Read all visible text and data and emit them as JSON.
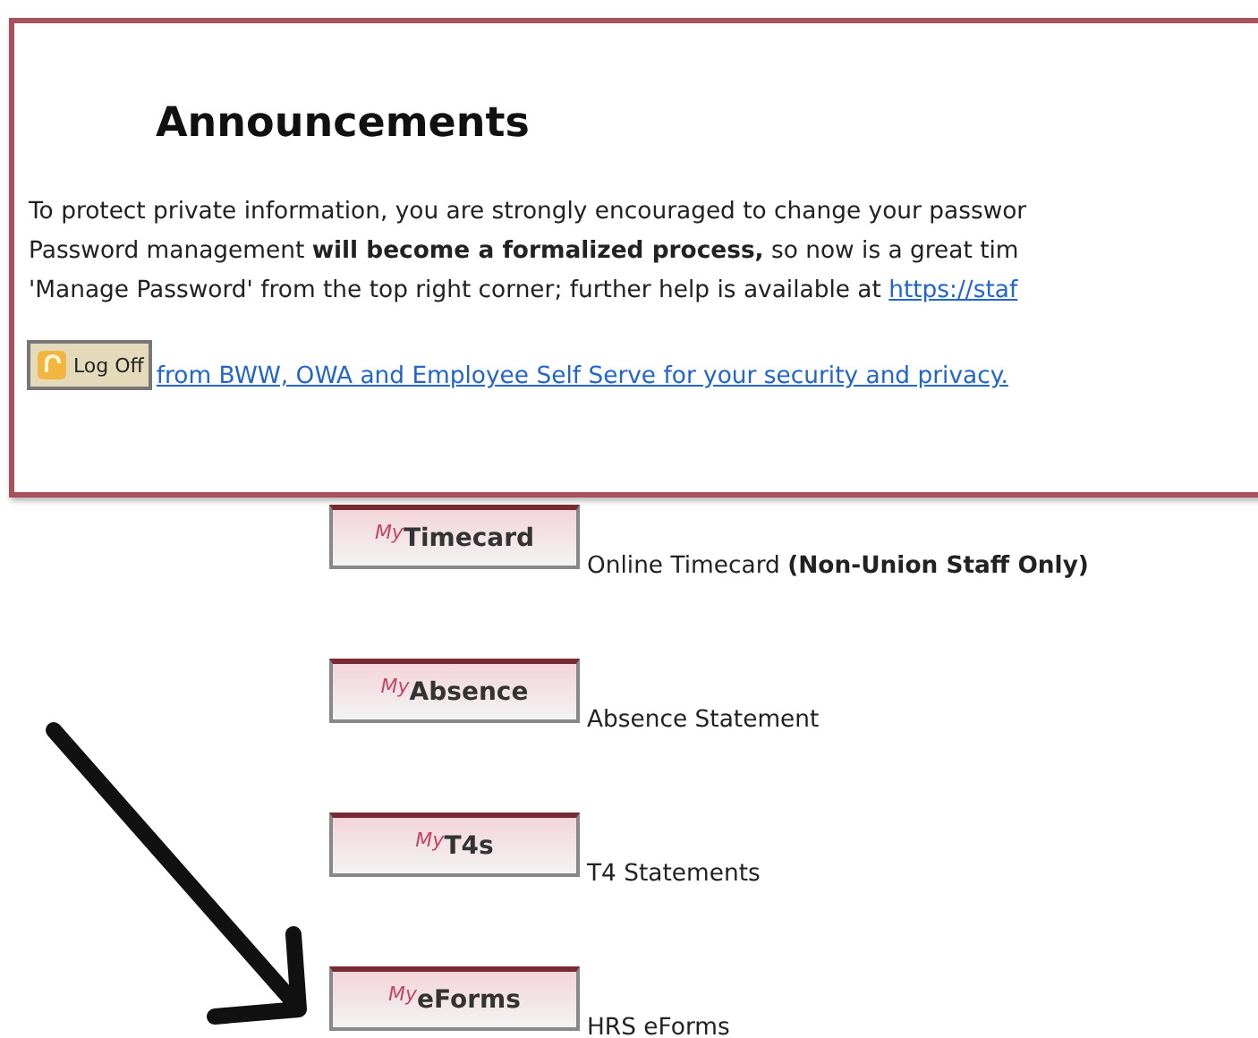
{
  "announcements": {
    "title": "Announcements",
    "lines": [
      {
        "text": "To protect private information, you are strongly encouraged to change your passwor"
      },
      {
        "text": "Password management **will become a formalized process,** so now is a great tim"
      },
      {
        "text": "'Manage Password' from the top right corner; further help is available at ",
        "link": "https://staf"
      }
    ],
    "logoff_button": "Log Off",
    "logoff_link": "from BWW, OWA and Employee Self Serve for your security and privacy."
  },
  "apps": [
    {
      "prefix": "My",
      "label": "Timecard",
      "description": "Online Timecard **(Non-Union Staff Only)**"
    },
    {
      "prefix": "My",
      "label": "Absence",
      "description": "Absence Statement"
    },
    {
      "prefix": "My",
      "label": "T4s",
      "description": "T4 Statements"
    },
    {
      "prefix": "My",
      "label": "eForms",
      "description": "HRS eForms"
    }
  ]
}
